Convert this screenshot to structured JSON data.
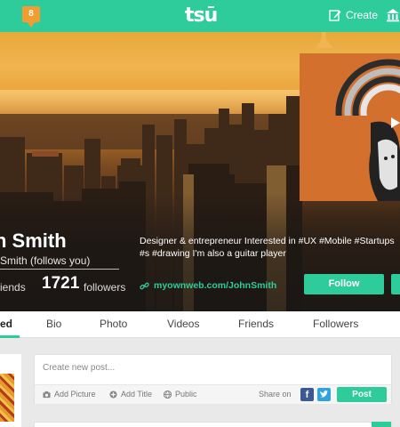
{
  "topbar": {
    "notification_count": "8",
    "logo": "tsū",
    "create_label": "Create",
    "accent_color": "#2ecc9a"
  },
  "profile": {
    "name_visible": "n Smith",
    "username_visible": "Smith (follows you)",
    "friends_label_visible": "iends",
    "followers_count": "1721",
    "followers_label": "followers",
    "bio": "Designer & entrepreneur Interested in #UX #Mobile #Startups #s #drawing I'm also a guitar player",
    "website": "myownweb.com/JohnSmith",
    "follow_label": "Follow"
  },
  "tabs": [
    {
      "label": "ed",
      "active": true
    },
    {
      "label": "Bio",
      "active": false
    },
    {
      "label": "Photo",
      "active": false
    },
    {
      "label": "Videos",
      "active": false
    },
    {
      "label": "Friends",
      "active": false
    },
    {
      "label": "Followers",
      "active": false
    }
  ],
  "composer": {
    "placeholder": "Create new post...",
    "add_picture": "Add Picture",
    "add_title": "Add Title",
    "visibility": "Public",
    "share_on": "Share on",
    "facebook_glyph": "f",
    "twitter_glyph": "t",
    "post_label": "Post"
  },
  "icons": {
    "create": "pencil-icon",
    "bank": "bank-icon",
    "link": "link-icon",
    "picture": "camera-icon",
    "title": "plus-circle-icon",
    "public": "globe-icon"
  }
}
